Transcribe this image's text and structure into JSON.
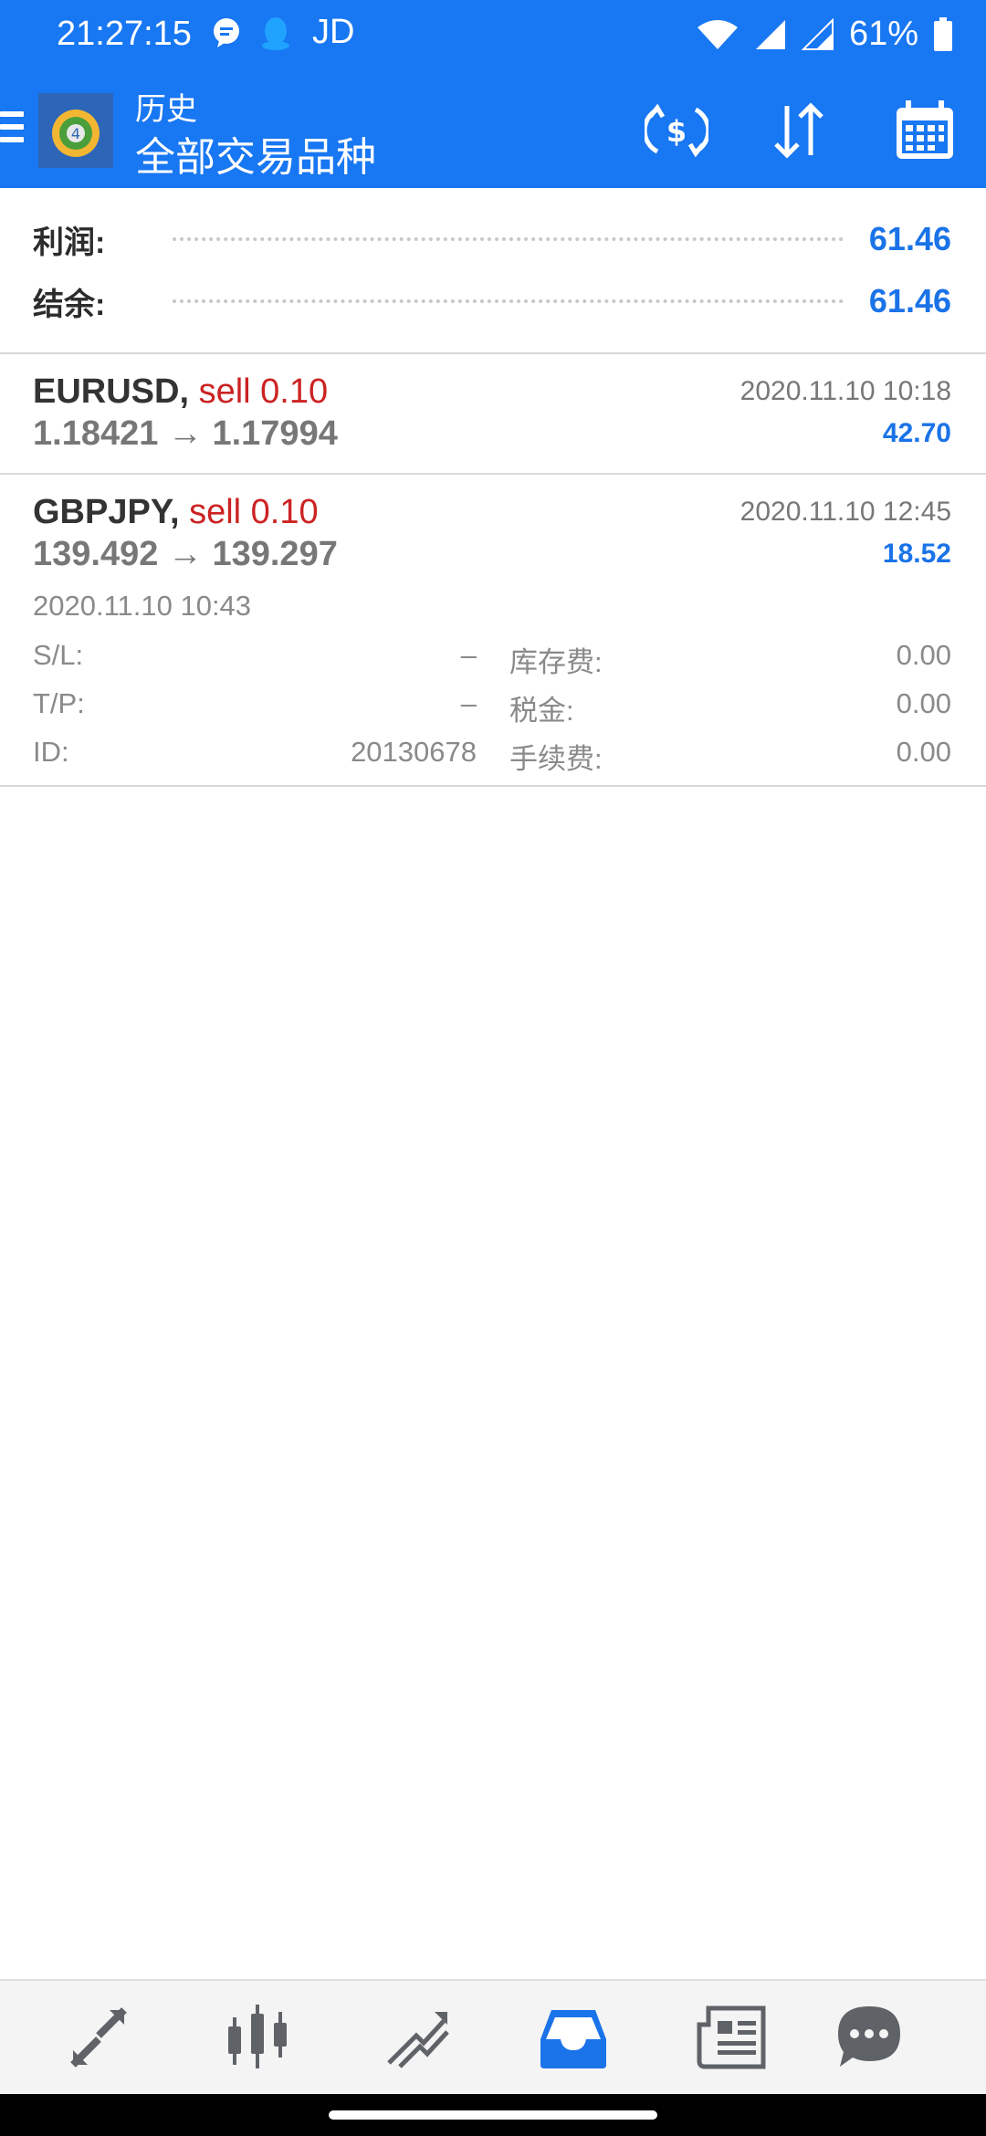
{
  "status_bar": {
    "time": "21:27:15",
    "carrier_label": "JD",
    "battery": "61%",
    "icons": [
      "chat-bubble-icon",
      "qq-penguin-icon",
      "wifi-icon",
      "signal-icon",
      "signal-icon",
      "battery-icon"
    ]
  },
  "app_bar": {
    "title_small": "历史",
    "title_large": "全部交易品种",
    "actions": [
      "currency-exchange-icon",
      "sort-icon",
      "calendar-icon"
    ]
  },
  "summary": {
    "profit_label": "利润:",
    "profit_value": "61.46",
    "balance_label": "结余:",
    "balance_value": "61.46"
  },
  "trades": [
    {
      "symbol": "EURUSD,",
      "type": "sell 0.10",
      "prices": "1.18421 → 1.17994",
      "close_time": "2020.11.10 10:18",
      "profit": "42.70"
    },
    {
      "symbol": "GBPJPY,",
      "type": "sell 0.10",
      "prices": "139.492 → 139.297",
      "close_time": "2020.11.10 12:45",
      "profit": "18.52",
      "open_time": "2020.11.10 10:43",
      "sl_label": "S/L:",
      "sl_value": "–",
      "tp_label": "T/P:",
      "tp_value": "–",
      "id_label": "ID:",
      "id_value": "20130678",
      "swap_label": "库存费:",
      "swap_value": "0.00",
      "tax_label": "税金:",
      "tax_value": "0.00",
      "fee_label": "手续费:",
      "fee_value": "0.00"
    }
  ],
  "bottom_nav": {
    "items": [
      "quotes-icon",
      "chart-candles-icon",
      "trade-icon",
      "history-inbox-icon",
      "news-icon",
      "chat-icon"
    ],
    "active_index": 3,
    "active_color": "#1a73e8",
    "inactive_color": "#5f6368"
  },
  "colors": {
    "primary": "#1877f2",
    "profit_blue": "#1a73e8",
    "sell_red": "#cc2222"
  }
}
